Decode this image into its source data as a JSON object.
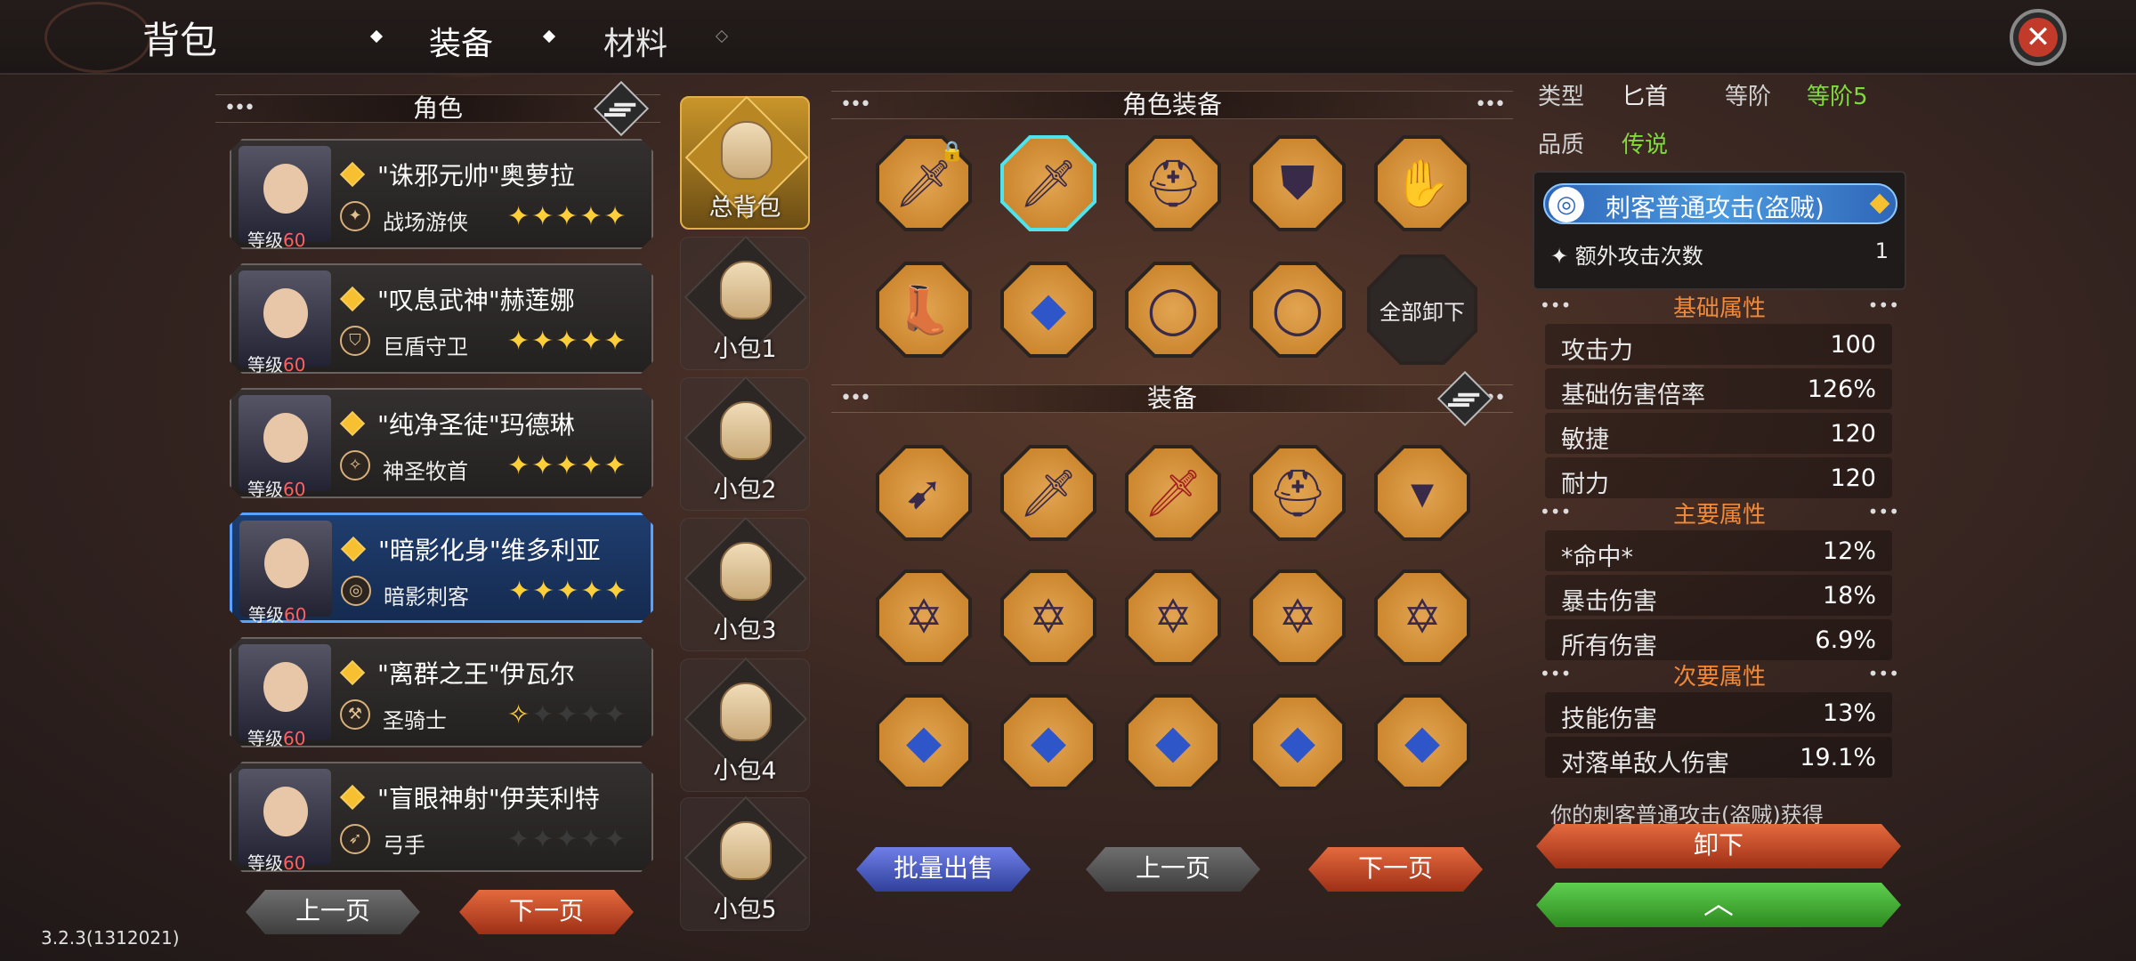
{
  "header": {
    "title": "背包",
    "tabs": [
      {
        "label": "装备",
        "active": true
      },
      {
        "label": "材料",
        "active": false
      }
    ]
  },
  "characters": {
    "section_title": "角色",
    "level_label": "等级",
    "items": [
      {
        "name": "\"诛邪元帅\"奥萝拉",
        "class": "战场游侠",
        "level": "60",
        "stars": 5,
        "selected": false
      },
      {
        "name": "\"叹息武神\"赫莲娜",
        "class": "巨盾守卫",
        "level": "60",
        "stars": 5,
        "selected": false
      },
      {
        "name": "\"纯净圣徒\"玛德琳",
        "class": "神圣牧首",
        "level": "60",
        "stars": 5,
        "selected": false
      },
      {
        "name": "\"暗影化身\"维多利亚",
        "class": "暗影刺客",
        "level": "60",
        "stars": 5,
        "selected": true
      },
      {
        "name": "\"离群之王\"伊瓦尔",
        "class": "圣骑士",
        "level": "60",
        "stars": 0,
        "selected": false
      },
      {
        "name": "\"盲眼神射\"伊芙利特",
        "class": "弓手",
        "level": "60",
        "stars": 0,
        "selected": false
      }
    ],
    "prev_label": "上一页",
    "next_label": "下一页"
  },
  "bags": {
    "items": [
      "总背包",
      "小包1",
      "小包2",
      "小包3",
      "小包4",
      "小包5"
    ]
  },
  "character_equipment": {
    "section_title": "角色装备",
    "slots": [
      "sword-icon",
      "dagger-icon",
      "helmet-icon",
      "armor-icon",
      "gloves-icon",
      "boots-icon",
      "necklace-icon",
      "ring-icon",
      "ring-icon"
    ],
    "unequip_all_label": "全部卸下"
  },
  "equipment": {
    "section_title": "装备",
    "items": [
      "spear-icon",
      "dagger-icon",
      "sword-icon",
      "helmet-icon",
      "necklace-icon",
      "hexagram-rune-icon",
      "hexagram-rune-icon",
      "hexagram-rune-icon",
      "hexagram-rune-icon",
      "hexagram-rune-icon",
      "sapphire-amulet-icon",
      "sapphire-amulet-icon",
      "sapphire-amulet-icon",
      "sapphire-amulet-icon",
      "sapphire-amulet-icon"
    ],
    "bulk_sell_label": "批量出售",
    "prev_label": "上一页",
    "next_label": "下一页"
  },
  "details": {
    "type_label": "类型",
    "type_value": "匕首",
    "tier_label": "等阶",
    "tier_value": "等阶5",
    "quality_label": "品质",
    "quality_value": "传说",
    "skill_name": "刺客普通攻击(盗贼)",
    "extra_label": "额外攻击次数",
    "extra_value": "1",
    "basic_title": "基础属性",
    "basic": [
      {
        "k": "攻击力",
        "v": "100"
      },
      {
        "k": "基础伤害倍率",
        "v": "126%"
      },
      {
        "k": "敏捷",
        "v": "120"
      },
      {
        "k": "耐力",
        "v": "120"
      }
    ],
    "main_title": "主要属性",
    "main": [
      {
        "k": "*命中*",
        "v": "12%"
      },
      {
        "k": "暴击伤害",
        "v": "18%"
      },
      {
        "k": "所有伤害",
        "v": "6.9%"
      }
    ],
    "secondary_title": "次要属性",
    "secondary": [
      {
        "k": "技能伤害",
        "v": "13%"
      },
      {
        "k": "对落单敌人伤害",
        "v": "19.1%"
      }
    ],
    "description": "你的刺客普通攻击(盗贼)获得",
    "unequip_label": "卸下"
  },
  "version": "3.2.3(1312021)",
  "colors": {
    "accent_green": "#7ddc3a",
    "accent_orange": "#f08a3a",
    "selected_blue": "#5aa0ff",
    "legend_red": "#ff6060"
  }
}
